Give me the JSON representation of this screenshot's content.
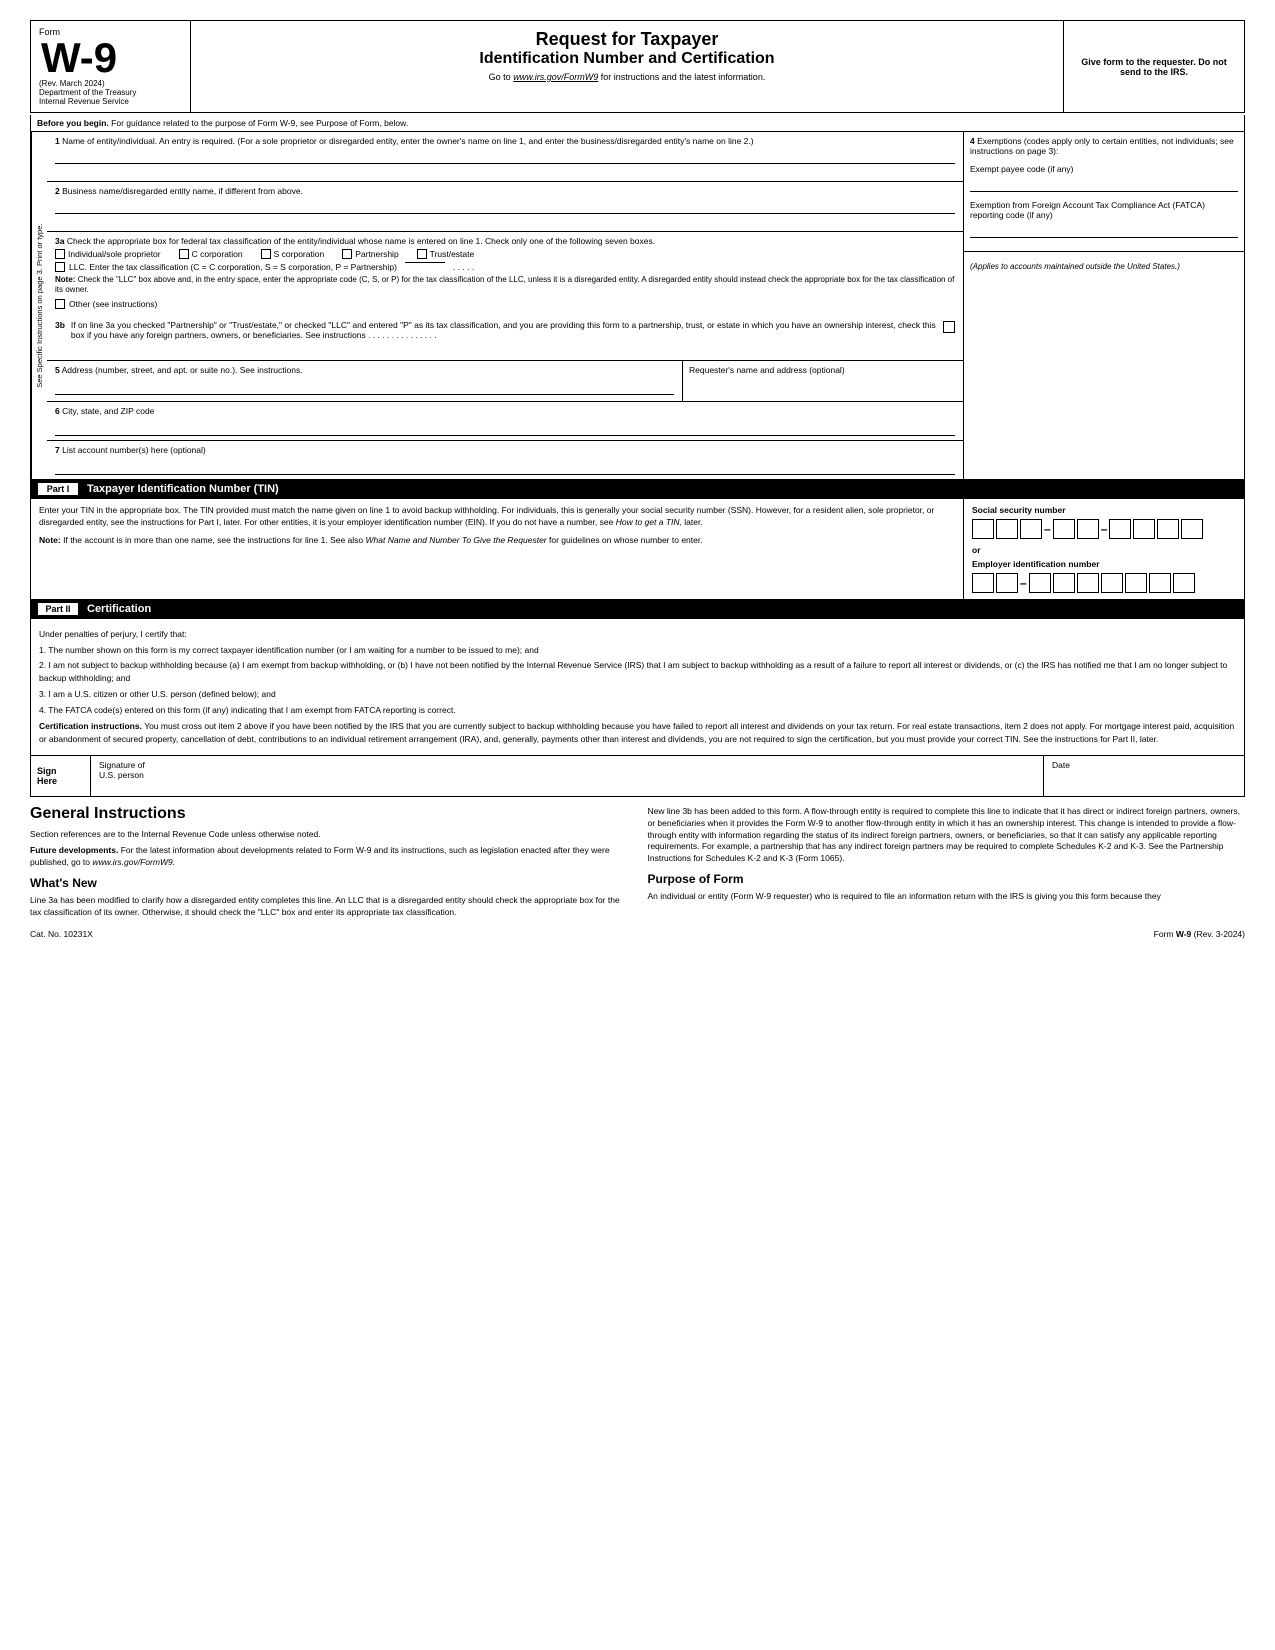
{
  "header": {
    "form_label": "Form",
    "form_number": "W-9",
    "rev_date": "(Rev. March 2024)",
    "dept": "Department of the Treasury",
    "irs": "Internal Revenue Service",
    "title1": "Request for Taxpayer",
    "title2": "Identification Number and Certification",
    "go_to": "Go to",
    "url": "www.irs.gov/FormW9",
    "url_suffix": "for instructions and the latest information.",
    "give_form": "Give form to the requester. Do not send to the IRS."
  },
  "before_begin": {
    "label": "Before you begin.",
    "text": "For guidance related to the purpose of Form W-9, see Purpose of Form, below."
  },
  "fields": {
    "field1_num": "1",
    "field1_label": "Name of entity/individual. An entry is required. (For a sole proprietor or disregarded entity, enter the owner's name on line 1, and enter the business/disregarded entity's name on line 2.)",
    "field2_num": "2",
    "field2_label": "Business name/disregarded entity name, if different from above.",
    "field3a_num": "3a",
    "field3a_label": "Check the appropriate box for federal tax classification of the entity/individual whose name is entered on line 1. Check only one of the following seven boxes.",
    "checkbox_individual": "Individual/sole proprietor",
    "checkbox_c_corp": "C corporation",
    "checkbox_s_corp": "S corporation",
    "checkbox_partnership": "Partnership",
    "checkbox_trust": "Trust/estate",
    "checkbox_llc": "LLC. Enter the tax classification (C = C corporation, S = S corporation, P = Partnership)",
    "llc_dots": ". . . . .",
    "note_label": "Note:",
    "note_text": "Check the \"LLC\" box above and, in the entry space, enter the appropriate code (C, S, or P) for the tax classification of the LLC, unless it is a disregarded entity. A disregarded entity should instead check the appropriate box for the tax classification of its owner.",
    "checkbox_other": "Other (see instructions)",
    "field3b_num": "3b",
    "field3b_text": "If on line 3a you checked \"Partnership\" or \"Trust/estate,\" or checked \"LLC\" and entered \"P\" as its tax classification, and you are providing this form to a partnership, trust, or estate in which you have an ownership interest, check this box if you have any foreign partners, owners, or beneficiaries. See instructions . . . . . . . . . . . . . . .",
    "field4_num": "4",
    "field4_label": "Exemptions (codes apply only to certain entities, not individuals; see instructions on page 3):",
    "exempt_payee": "Exempt payee code (if any)",
    "exempt_fatca": "Exemption from Foreign Account Tax Compliance Act (FATCA) reporting code (if any)",
    "applies_text": "(Applies to accounts maintained outside the United States.)",
    "field5_num": "5",
    "field5_label": "Address (number, street, and apt. or suite no.). See instructions.",
    "field5_right": "Requester's name and address (optional)",
    "field6_num": "6",
    "field6_label": "City, state, and ZIP code",
    "field7_num": "7",
    "field7_label": "List account number(s) here (optional)",
    "sidebar_text": "See Specific Instructions on page 3.   Print or type."
  },
  "part1": {
    "label": "Part I",
    "title": "Taxpayer Identification Number (TIN)",
    "tin_text1": "Enter your TIN in the appropriate box. The TIN provided must match the name given on line 1 to avoid backup withholding. For individuals, this is generally your social security number (SSN). However, for a resident alien, sole proprietor, or disregarded entity, see the instructions for Part I, later. For other entities, it is your employer identification number (EIN). If you do not have a number, see",
    "tin_text1_italic": "How to get a TIN,",
    "tin_text1_end": "later.",
    "tin_note_label": "Note:",
    "tin_note": "If the account is in more than one name, see the instructions for line 1. See also",
    "tin_note_italic": "What Name and Number To Give the Requester",
    "tin_note_end": "for guidelines on whose number to enter.",
    "ssn_label": "Social security number",
    "or_label": "or",
    "ein_label": "Employer identification number"
  },
  "part2": {
    "label": "Part II",
    "title": "Certification",
    "under_penalties": "Under penalties of perjury, I certify that:",
    "item1": "1. The number shown on this form is my correct taxpayer identification number (or I am waiting for a number to be issued to me); and",
    "item2": "2. I am not subject to backup withholding because (a) I am exempt from backup withholding, or (b) I have not been notified by the Internal Revenue Service (IRS) that I am subject to backup withholding as a result of a failure to report all interest or dividends, or (c) the IRS has notified me that I am no longer subject to backup withholding; and",
    "item3": "3. I am a U.S. citizen or other U.S. person (defined below); and",
    "item4": "4. The FATCA code(s) entered on this form (if any) indicating that I am exempt from FATCA reporting is correct.",
    "cert_instructions_label": "Certification instructions.",
    "cert_instructions": "You must cross out item 2 above if you have been notified by the IRS that you are currently subject to backup withholding because you have failed to report all interest and dividends on your tax return. For real estate transactions, item 2 does not apply. For mortgage interest paid, acquisition or abandonment of secured property, cancellation of debt, contributions to an individual retirement arrangement (IRA), and, generally, payments other than interest and dividends, you are not required to sign the certification, but you must provide your correct TIN. See the instructions for Part II, later."
  },
  "sign_here": {
    "sign": "Sign",
    "here": "Here",
    "sig_label": "Signature of",
    "sig_sub": "U.S. person",
    "date_label": "Date"
  },
  "general": {
    "title": "General Instructions",
    "section_refs": "Section references are to the Internal Revenue Code unless otherwise noted.",
    "future_label": "Future developments.",
    "future_text": "For the latest information about developments related to Form W-9 and its instructions, such as legislation enacted after they were published, go to",
    "future_url": "www.irs.gov/FormW9.",
    "whats_new_title": "What's New",
    "whats_new_text": "Line 3a has been modified to clarify how a disregarded entity completes this line. An LLC that is a disregarded entity should check the appropriate box for the tax classification of its owner. Otherwise, it should check the \"LLC\" box and enter its appropriate tax classification.",
    "right_para1": "New line 3b has been added to this form. A flow-through entity is required to complete this line to indicate that it has direct or indirect foreign partners, owners, or beneficiaries when it provides the Form W-9 to another flow-through entity in which it has an ownership interest. This change is intended to provide a flow-through entity with information regarding the status of its indirect foreign partners, owners, or beneficiaries, so that it can satisfy any applicable reporting requirements. For example, a partnership that has any indirect foreign partners may be required to complete Schedules K-2 and K-3. See the Partnership Instructions for Schedules K-2 and K-3 (Form 1065).",
    "purpose_title": "Purpose of Form",
    "purpose_text": "An individual or entity (Form W-9 requester) who is required to file an information return with the IRS is giving you this form because they"
  },
  "footer": {
    "cat_no": "Cat. No. 10231X",
    "form_label": "Form",
    "form_ref": "W-9",
    "rev": "(Rev. 3-2024)"
  }
}
